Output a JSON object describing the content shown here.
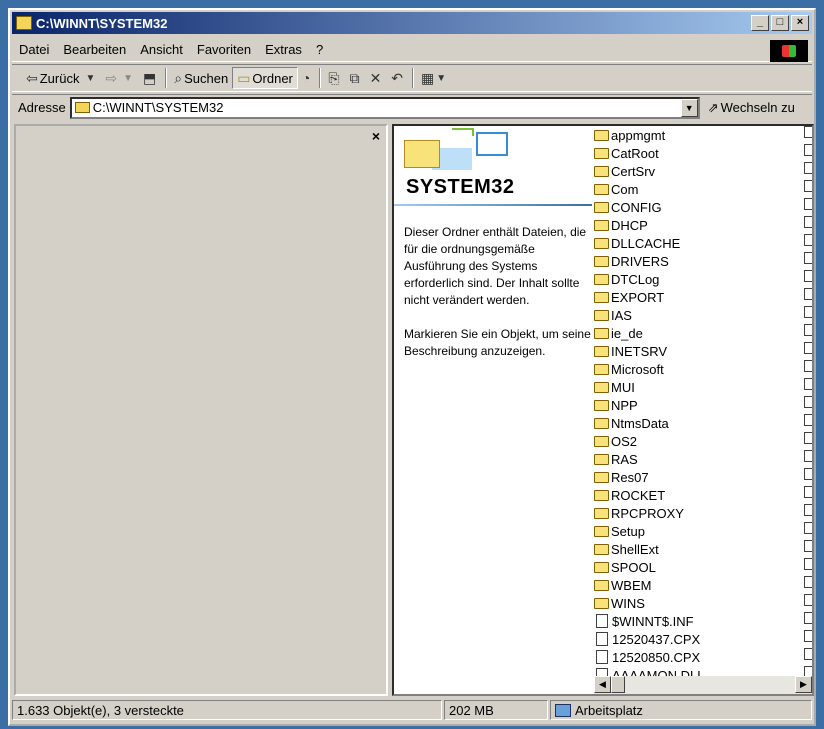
{
  "window": {
    "title": "C:\\WINNT\\SYSTEM32"
  },
  "title_buttons": {
    "minimize": "_",
    "maximize": "□",
    "close": "×"
  },
  "menu": [
    "Datei",
    "Bearbeiten",
    "Ansicht",
    "Favoriten",
    "Extras",
    "?"
  ],
  "toolbar": {
    "back": "Zurück",
    "search": "Suchen",
    "folders": "Ordner"
  },
  "address": {
    "label": "Adresse",
    "value": "C:\\WINNT\\SYSTEM32",
    "go": "Wechseln zu"
  },
  "left_pane": {
    "close": "×"
  },
  "info": {
    "heading": "SYSTEM32",
    "para1": "Dieser Ordner enthält Dateien, die für die ordnungsgemäße Ausführung des Systems erforderlich sind. Der Inhalt sollte nicht verändert werden.",
    "para2": "Markieren Sie ein Objekt, um seine Beschreibung anzuzeigen."
  },
  "files": [
    {
      "name": "appmgmt",
      "type": "folder"
    },
    {
      "name": "CatRoot",
      "type": "folder"
    },
    {
      "name": "CertSrv",
      "type": "folder"
    },
    {
      "name": "Com",
      "type": "folder"
    },
    {
      "name": "CONFIG",
      "type": "folder"
    },
    {
      "name": "DHCP",
      "type": "folder"
    },
    {
      "name": "DLLCACHE",
      "type": "folder"
    },
    {
      "name": "DRIVERS",
      "type": "folder"
    },
    {
      "name": "DTCLog",
      "type": "folder"
    },
    {
      "name": "EXPORT",
      "type": "folder"
    },
    {
      "name": "IAS",
      "type": "folder"
    },
    {
      "name": "ie_de",
      "type": "folder"
    },
    {
      "name": "INETSRV",
      "type": "folder"
    },
    {
      "name": "Microsoft",
      "type": "folder"
    },
    {
      "name": "MUI",
      "type": "folder"
    },
    {
      "name": "NPP",
      "type": "folder"
    },
    {
      "name": "NtmsData",
      "type": "folder"
    },
    {
      "name": "OS2",
      "type": "folder"
    },
    {
      "name": "RAS",
      "type": "folder"
    },
    {
      "name": "Res07",
      "type": "folder"
    },
    {
      "name": "ROCKET",
      "type": "folder"
    },
    {
      "name": "RPCPROXY",
      "type": "folder"
    },
    {
      "name": "Setup",
      "type": "folder"
    },
    {
      "name": "ShellExt",
      "type": "folder"
    },
    {
      "name": "SPOOL",
      "type": "folder"
    },
    {
      "name": "WBEM",
      "type": "folder"
    },
    {
      "name": "WINS",
      "type": "folder"
    },
    {
      "name": "$WINNT$.INF",
      "type": "file"
    },
    {
      "name": "12520437.CPX",
      "type": "file"
    },
    {
      "name": "12520850.CPX",
      "type": "file"
    },
    {
      "name": "AAAAMON.DLL",
      "type": "file"
    }
  ],
  "status": {
    "objects": "1.633 Objekt(e), 3 versteckte",
    "size": "202 MB",
    "location": "Arbeitsplatz"
  }
}
